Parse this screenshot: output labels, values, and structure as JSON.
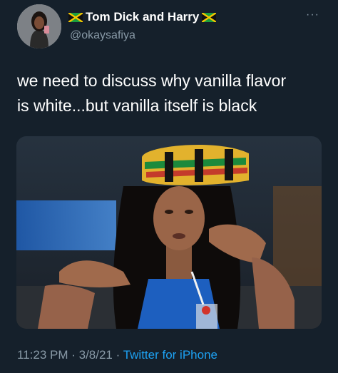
{
  "tweet": {
    "display_name": "Tom Dick and Harry",
    "handle": "@okaysafiya",
    "more": "···",
    "text_line1": "we need to discuss why vanilla flavor",
    "text_line2": "is white...but vanilla itself is black",
    "time": "11:23 PM",
    "separator1": " · ",
    "date": "3/8/21",
    "separator2": " · ",
    "source": "Twitter for iPhone"
  },
  "icons": {
    "flag_left": "jamaica-flag-icon",
    "flag_right": "jamaica-flag-icon",
    "more": "more-options-icon"
  },
  "colors": {
    "background": "#15202b",
    "secondary_text": "#8899a6",
    "link": "#1da1f2"
  }
}
